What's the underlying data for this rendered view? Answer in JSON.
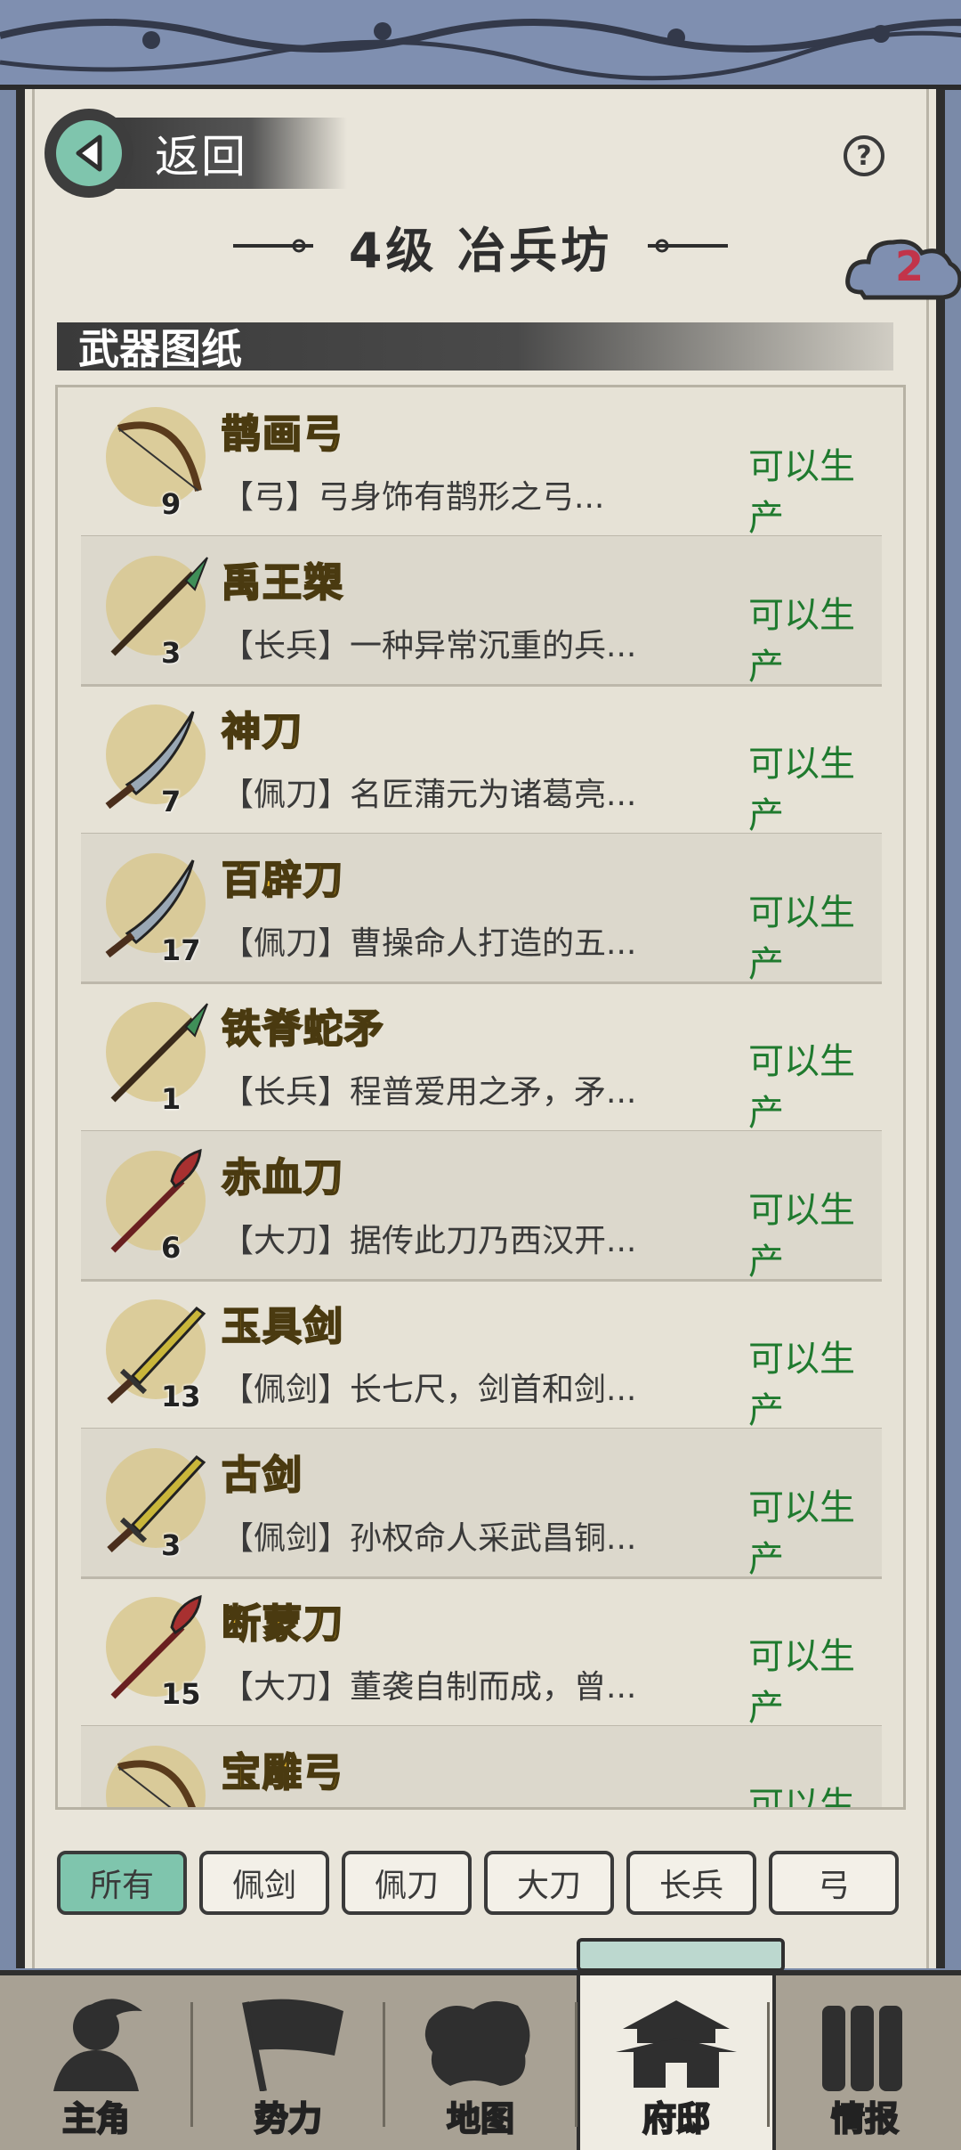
{
  "header": {
    "back_label": "返回",
    "help_symbol": "?",
    "title": "4级  冶兵坊",
    "badge_count": "2"
  },
  "section": {
    "title": "武器图纸"
  },
  "items": [
    {
      "name": "鹊画弓",
      "count": "9",
      "desc": "【弓】弓身饰有鹊形之弓...",
      "status": "可以生产",
      "icon": "bow-icon"
    },
    {
      "name": "禹王槊",
      "count": "3",
      "desc": "【长兵】一种异常沉重的兵...",
      "status": "可以生产",
      "icon": "spear-icon"
    },
    {
      "name": "神刀",
      "count": "7",
      "desc": "【佩刀】名匠蒲元为诸葛亮...",
      "status": "可以生产",
      "icon": "saber-icon"
    },
    {
      "name": "百辟刀",
      "count": "17",
      "desc": "【佩刀】曹操命人打造的五...",
      "status": "可以生产",
      "icon": "saber-icon"
    },
    {
      "name": "铁脊蛇矛",
      "count": "1",
      "desc": "【长兵】程普爱用之矛，矛...",
      "status": "可以生产",
      "icon": "spear-icon"
    },
    {
      "name": "赤血刀",
      "count": "6",
      "desc": "【大刀】据传此刀乃西汉开...",
      "status": "可以生产",
      "icon": "glaive-icon"
    },
    {
      "name": "玉具剑",
      "count": "13",
      "desc": "【佩剑】长七尺，剑首和剑...",
      "status": "可以生产",
      "icon": "sword-icon"
    },
    {
      "name": "古剑",
      "count": "3",
      "desc": "【佩剑】孙权命人采武昌铜...",
      "status": "可以生产",
      "icon": "sword-icon"
    },
    {
      "name": "断蒙刀",
      "count": "15",
      "desc": "【大刀】董袭自制而成，曾...",
      "status": "可以生产",
      "icon": "glaive-icon"
    },
    {
      "name": "宝雕弓",
      "count": "",
      "desc": "",
      "status": "可以生产",
      "icon": "bow-icon"
    }
  ],
  "filters": [
    {
      "label": "所有",
      "active": true
    },
    {
      "label": "佩剑",
      "active": false
    },
    {
      "label": "佩刀",
      "active": false
    },
    {
      "label": "大刀",
      "active": false
    },
    {
      "label": "长兵",
      "active": false
    },
    {
      "label": "弓",
      "active": false
    }
  ],
  "nav": [
    {
      "label": "主角",
      "icon": "hero-icon"
    },
    {
      "label": "势力",
      "icon": "flag-icon"
    },
    {
      "label": "地图",
      "icon": "map-icon"
    },
    {
      "label": "府邸",
      "icon": "mansion-icon",
      "active": true
    },
    {
      "label": "情报",
      "icon": "scroll-icon"
    }
  ],
  "colors": {
    "accent": "#7fc5ad",
    "status_green": "#1f7a2e",
    "item_name_gold": "#e8b629",
    "badge_red": "#c2344a"
  }
}
